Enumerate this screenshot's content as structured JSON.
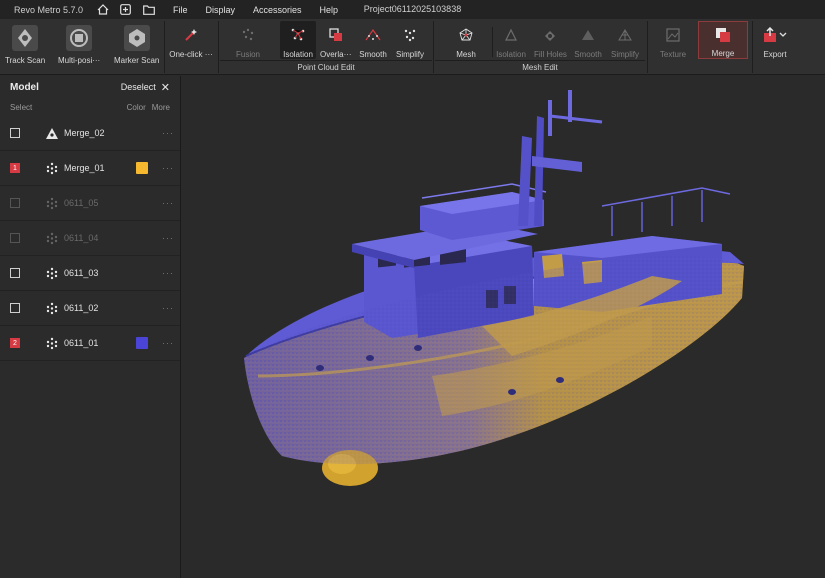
{
  "app": {
    "title": "Revo Metro 5.7.0",
    "project": "Project06112025103838",
    "menu": [
      "File",
      "Display",
      "Accessories",
      "Help"
    ]
  },
  "toolbar": {
    "scan_tools": [
      {
        "label": "Track Scan",
        "icon": "track-scan-icon"
      },
      {
        "label": "Multi-posi···",
        "icon": "multi-position-icon"
      },
      {
        "label": "Marker Scan",
        "icon": "marker-scan-icon"
      }
    ],
    "one_click": "One-click ···",
    "point_cloud_edit": {
      "group_label": "Point Cloud Edit",
      "tools": [
        "Fusion",
        "Isolation",
        "Overla···",
        "Smooth",
        "Simplify"
      ]
    },
    "mesh_edit": {
      "group_label": "Mesh Edit",
      "tools": [
        "Mesh",
        "Isolation",
        "Fill Holes",
        "Smooth",
        "Simplify"
      ]
    },
    "texture": "Texture",
    "merge": "Merge",
    "export": "Export"
  },
  "panel": {
    "title": "Model",
    "deselect": "Deselect",
    "col_select": "Select",
    "col_color": "Color",
    "col_more": "More",
    "rows": [
      {
        "name": "Merge_02",
        "check": "",
        "state": "normal",
        "icon": "mesh-icon",
        "color": ""
      },
      {
        "name": "Merge_01",
        "check": "1",
        "state": "selected",
        "icon": "point-cloud-icon",
        "color": "#f5b82e"
      },
      {
        "name": "0611_05",
        "check": "",
        "state": "dim",
        "icon": "point-cloud-icon",
        "color": ""
      },
      {
        "name": "0611_04",
        "check": "",
        "state": "dim",
        "icon": "point-cloud-icon",
        "color": ""
      },
      {
        "name": "0611_03",
        "check": "",
        "state": "normal",
        "icon": "point-cloud-icon",
        "color": ""
      },
      {
        "name": "0611_02",
        "check": "",
        "state": "normal",
        "icon": "point-cloud-icon",
        "color": ""
      },
      {
        "name": "0611_01",
        "check": "2",
        "state": "selected",
        "icon": "point-cloud-icon",
        "color": "#4a45d6"
      }
    ],
    "more_glyph": "···"
  },
  "colors": {
    "accent_red": "#d63a43",
    "cloud_yellow": "#d9a72a",
    "cloud_blue": "#4a45d6"
  }
}
